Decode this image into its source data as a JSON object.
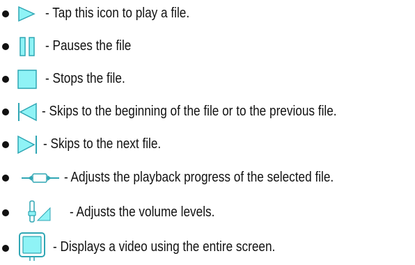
{
  "colors": {
    "icon_fill": "#8ff3f6",
    "icon_stroke": "#2fa6b4",
    "text": "#111111"
  },
  "items": [
    {
      "icon": "play-icon",
      "text": "- Tap this icon to play a file."
    },
    {
      "icon": "pause-icon",
      "text": "- Pauses the file"
    },
    {
      "icon": "stop-icon",
      "text": "- Stops the file."
    },
    {
      "icon": "skip-back-icon",
      "text": "- Skips to the beginning of the file or to the previous file."
    },
    {
      "icon": "skip-forward-icon",
      "text": "- Skips to the next file."
    },
    {
      "icon": "progress-slider-icon",
      "text": "- Adjusts the playback progress of the selected file."
    },
    {
      "icon": "volume-slider-icon",
      "text": "- Adjusts the volume levels."
    },
    {
      "icon": "fullscreen-icon",
      "text": "- Displays a video using the entire screen."
    }
  ]
}
